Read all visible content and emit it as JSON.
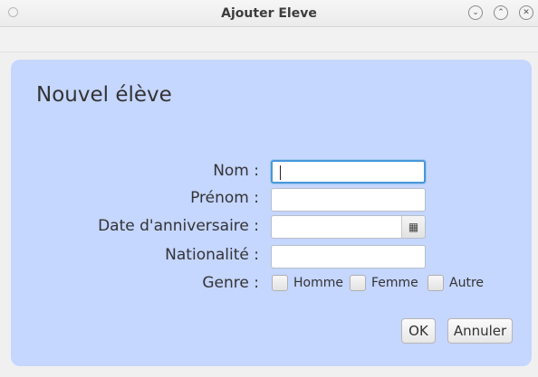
{
  "window": {
    "title": "Ajouter Eleve"
  },
  "dialog": {
    "heading": "Nouvel élève"
  },
  "form": {
    "nom": {
      "label": "Nom :",
      "value": ""
    },
    "prenom": {
      "label": "Prénom :",
      "value": ""
    },
    "date": {
      "label": "Date d'anniversaire :",
      "value": "",
      "icon": "calendar-icon"
    },
    "nationalite": {
      "label": "Nationalité :",
      "value": ""
    },
    "genre": {
      "label": "Genre :",
      "options": [
        {
          "label": "Homme",
          "checked": false
        },
        {
          "label": "Femme",
          "checked": false
        },
        {
          "label": "Autre",
          "checked": false
        }
      ]
    }
  },
  "buttons": {
    "ok": "OK",
    "cancel": "Annuler"
  },
  "colors": {
    "panel": "#c5d6ff",
    "focus": "#4a97d9"
  }
}
